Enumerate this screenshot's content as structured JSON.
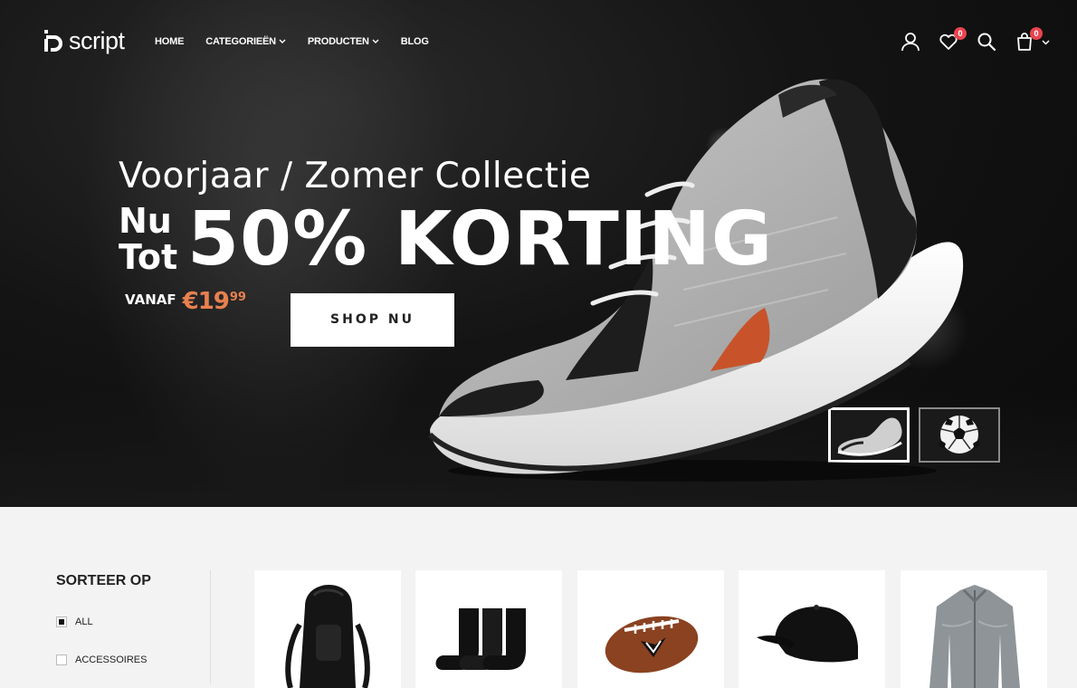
{
  "brand": {
    "logo_text": "script"
  },
  "nav": {
    "items": [
      {
        "label": "HOME",
        "dropdown": false
      },
      {
        "label": "CATEGORIEËN",
        "dropdown": true
      },
      {
        "label": "PRODUCTEN",
        "dropdown": true
      },
      {
        "label": "BLOG",
        "dropdown": false
      }
    ]
  },
  "header_icons": {
    "user": "user-icon",
    "wishlist": {
      "icon": "heart-icon",
      "count": "0"
    },
    "search": "search-icon",
    "cart": {
      "icon": "shopping-bag-icon",
      "count": "0"
    }
  },
  "hero": {
    "subtitle": "Voorjaar / Zomer Collectie",
    "nu": "Nu",
    "tot": "Tot",
    "headline": "50% KORTING",
    "from_label": "VANAF",
    "price_main": "€19",
    "price_cents": "99",
    "cta": "SHOP NU",
    "accent_color": "#e8804f",
    "slides": [
      "sneaker-thumbnail",
      "soccer-ball-thumbnail"
    ],
    "active_slide": 0
  },
  "sidebar": {
    "title": "SORTEER OP",
    "filters": [
      {
        "label": "ALL",
        "checked": true
      },
      {
        "label": "ACCESSOIRES",
        "checked": false
      }
    ]
  },
  "products": [
    {
      "icon": "backpack-image"
    },
    {
      "icon": "socks-image"
    },
    {
      "icon": "american-football-image"
    },
    {
      "icon": "cap-image"
    },
    {
      "icon": "jacket-image"
    }
  ],
  "colors": {
    "badge": "#e8444f",
    "accent": "#e8804f"
  }
}
